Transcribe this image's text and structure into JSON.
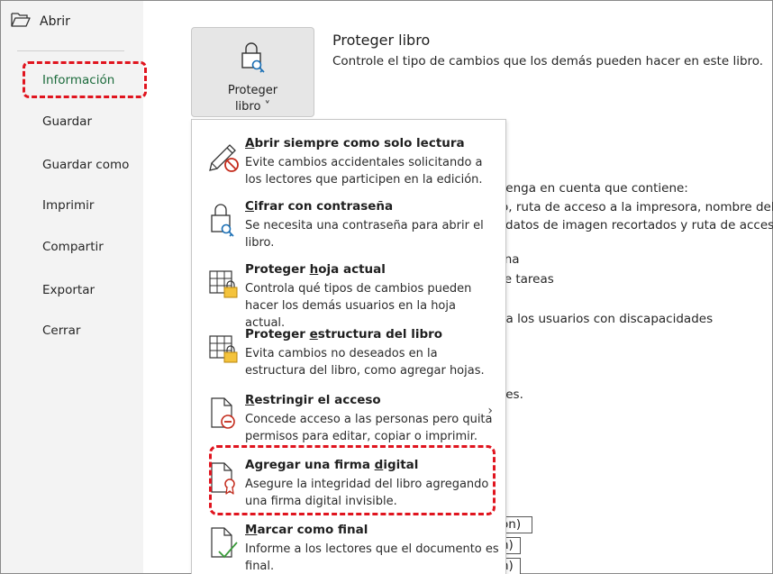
{
  "sidebar": {
    "open_label": "Abrir",
    "items": [
      {
        "label": "Información"
      },
      {
        "label": "Guardar"
      },
      {
        "label": "Guardar como"
      },
      {
        "label": "Imprimir"
      },
      {
        "label": "Compartir"
      },
      {
        "label": "Exportar"
      },
      {
        "label": "Cerrar"
      }
    ]
  },
  "protect": {
    "button_line1": "Proteger",
    "button_line2": "libro ˅",
    "title": "Proteger libro",
    "description": "Controle el tipo de cambios que los demás pueden hacer en este libro."
  },
  "background": {
    "lines": [
      "tenga en cuenta que contiene:",
      "o, ruta de acceso a la impresora, nombre del",
      "datos de imagen recortados y ruta de acceso",
      "ina",
      "le tareas",
      "ra los usuarios con discapacidades",
      "res."
    ],
    "boxes": [
      "ón)",
      "n)",
      "n)"
    ]
  },
  "menu": {
    "items": [
      {
        "title_u": "A",
        "title_rest": "brir siempre como solo lectura",
        "desc": "Evite cambios accidentales solicitando a los lectores que participen en la edición.",
        "icon": "pencil-no-edit-icon"
      },
      {
        "title_u": "C",
        "title_rest": "ifrar con contraseña",
        "desc": "Se necesita una contraseña para abrir el libro.",
        "icon": "lock-key-icon"
      },
      {
        "title_pre": "Proteger ",
        "title_u": "h",
        "title_rest": "oja actual",
        "desc": "Controla qué tipos de cambios pueden hacer los demás usuarios en la hoja actual.",
        "icon": "sheet-lock-icon"
      },
      {
        "title_pre": "Proteger ",
        "title_u": "e",
        "title_rest": "structura del libro",
        "desc": "Evita cambios no deseados en la estructura del libro, como agregar hojas.",
        "icon": "workbook-lock-icon"
      },
      {
        "title_u": "R",
        "title_rest": "estringir el acceso",
        "desc": "Concede acceso a las personas pero quita permisos para editar, copiar o imprimir.",
        "icon": "restrict-access-icon",
        "chevron": "›"
      },
      {
        "title_pre": "Agregar una firma ",
        "title_u": "d",
        "title_rest": "igital",
        "desc": "Asegure la integridad del libro agregando una firma digital invisible.",
        "icon": "digital-signature-icon"
      },
      {
        "title_u": "M",
        "title_rest": "arcar como final",
        "desc": "Informe a los lectores que el documento es final.",
        "icon": "mark-final-icon"
      }
    ]
  },
  "colors": {
    "accent_green": "#1c6b3c",
    "highlight_red": "#e0141e"
  }
}
